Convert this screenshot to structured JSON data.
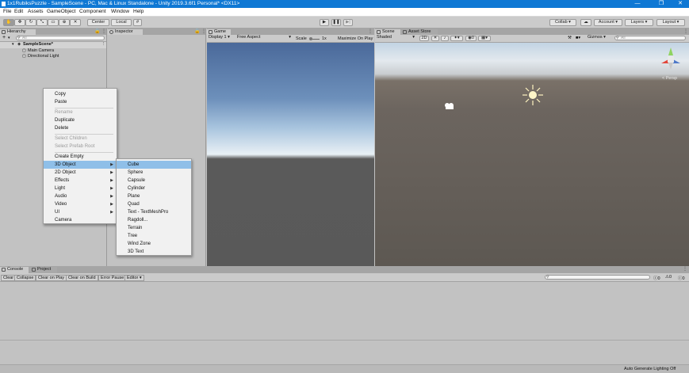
{
  "window": {
    "title": "1x1RubiksPuzzle - SampleScene - PC, Mac & Linux Standalone - Unity 2019.3.6f1 Personal* <DX11>",
    "controls": [
      "—",
      "❐",
      "✕"
    ]
  },
  "menubar": [
    "File",
    "Edit",
    "Assets",
    "GameObject",
    "Component",
    "Window",
    "Help"
  ],
  "toolbar": {
    "pivot": "Center",
    "space": "Local",
    "collab": "Collab",
    "account": "Account",
    "layers": "Layers",
    "layout": "Layout"
  },
  "hierarchy": {
    "tab": "Hierarchy",
    "add": "+",
    "search_placeholder": "All",
    "scene": "SampleScene*",
    "items": [
      "Main Camera",
      "Directional Light"
    ]
  },
  "inspector": {
    "tab": "Inspector"
  },
  "game": {
    "tab": "Game",
    "display": "Display 1",
    "aspect": "Free Aspect",
    "scale_label": "Scale",
    "scale_value": "1x",
    "maximize": "Maximize On Play"
  },
  "scene": {
    "tab": "Scene",
    "asset_store_tab": "Asset Store",
    "shading": "Shaded",
    "mode_2d": "2D",
    "hidden_count": "0",
    "gizmos": "Gizmos",
    "search_placeholder": "All",
    "persp": "< Persp"
  },
  "context_menu": {
    "items": [
      {
        "label": "Copy",
        "enabled": true
      },
      {
        "label": "Paste",
        "enabled": true
      },
      {
        "label": "Rename",
        "enabled": false
      },
      {
        "label": "Duplicate",
        "enabled": true
      },
      {
        "label": "Delete",
        "enabled": true
      },
      {
        "label": "Select Children",
        "enabled": false
      },
      {
        "label": "Select Prefab Root",
        "enabled": false
      },
      {
        "label": "Create Empty",
        "enabled": true
      },
      {
        "label": "3D Object",
        "enabled": true
      },
      {
        "label": "2D Object",
        "enabled": true
      },
      {
        "label": "Effects",
        "enabled": true
      },
      {
        "label": "Light",
        "enabled": true
      },
      {
        "label": "Audio",
        "enabled": true
      },
      {
        "label": "Video",
        "enabled": true
      },
      {
        "label": "UI",
        "enabled": true
      },
      {
        "label": "Camera",
        "enabled": true
      }
    ]
  },
  "submenu_3d": [
    "Cube",
    "Sphere",
    "Capsule",
    "Cylinder",
    "Plane",
    "Quad",
    "Text - TextMeshPro",
    "Ragdoll...",
    "Terrain",
    "Tree",
    "Wind Zone",
    "3D Text"
  ],
  "console": {
    "tab": "Console",
    "project_tab": "Project",
    "buttons": [
      "Clear",
      "Collapse",
      "Clear on Play",
      "Clear on Build",
      "Error Pause",
      "Editor"
    ],
    "counts": [
      "0",
      "0",
      "0"
    ]
  },
  "statusbar": {
    "text": "Auto Generate Lighting Off"
  },
  "colors": {
    "titlebar": "#0f78d4",
    "highlight": "#8fbfe8"
  }
}
